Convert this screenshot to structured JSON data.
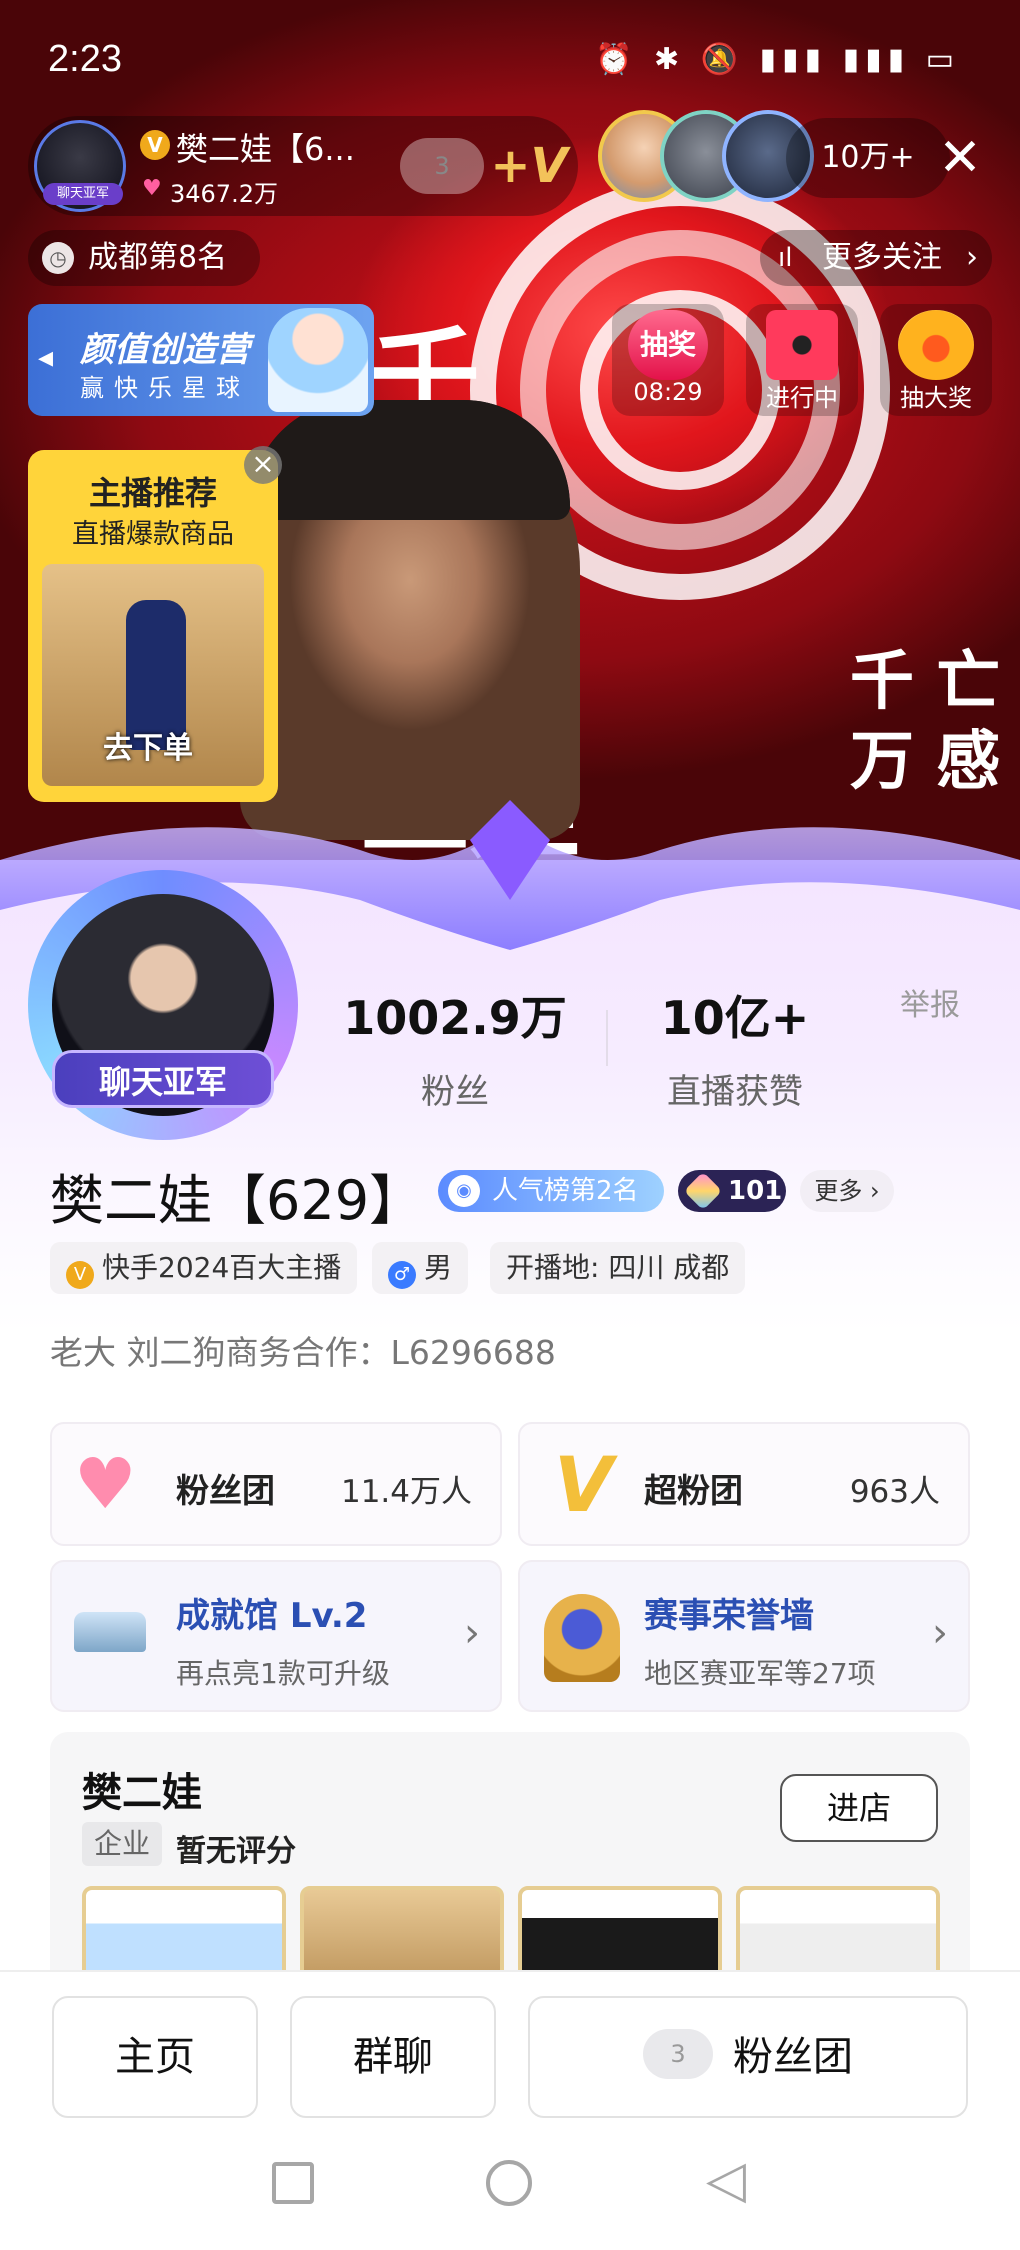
{
  "status_bar": {
    "time": "2:23"
  },
  "live": {
    "anchor_name": "樊二娃【6...",
    "anchor_likes": "3467.2万",
    "anchor_badge": "聊天亚军",
    "fan_level": "3",
    "viewer_count": "10万+",
    "city_rank": "成都第8名",
    "more_follow": "更多关注",
    "promo_title": "颜值创造营",
    "promo_sub": "赢快乐星球",
    "lottery_label": "抽奖",
    "lottery_timer": "08:29",
    "ongoing_label": "进行中",
    "big_prize_label": "抽大奖",
    "rec_title": "主播推荐",
    "rec_sub": "直播爆款商品",
    "rec_cta": "去下单"
  },
  "profile": {
    "avatar_ribbon": "聊天亚军",
    "fans_count": "1002.9万",
    "fans_label": "粉丝",
    "likes_count": "10亿+",
    "likes_label": "直播获赞",
    "report": "举报",
    "name": "樊二娃【629】",
    "popularity_rank": "人气榜第2名",
    "level": "101",
    "more": "更多",
    "tags": [
      "快手2024百大主播",
      "男",
      "开播地: 四川 成都"
    ],
    "bio": "老大 刘二狗商务合作：L6296688"
  },
  "cards": {
    "fan_club": {
      "name": "粉丝团",
      "value": "11.4万人"
    },
    "super_fan": {
      "name": "超粉团",
      "value": "963人"
    },
    "achievement": {
      "name": "成就馆 Lv.2",
      "sub": "再点亮1款可升级"
    },
    "honor": {
      "name": "赛事荣誉墙",
      "sub": "地区赛亚军等27项"
    }
  },
  "shop": {
    "name": "樊二娃",
    "tag": "企业",
    "rating": "暂无评分",
    "enter": "进店"
  },
  "bottom_bar": {
    "home": "主页",
    "group_chat": "群聊",
    "fan_club": "粉丝团",
    "fan_level": "3"
  },
  "icons": [
    "clock-icon",
    "chart-icon",
    "close-icon",
    "heart-icon",
    "v-icon",
    "crown-icon",
    "trophy-icon",
    "square-nav-icon",
    "circle-nav-icon",
    "back-nav-icon"
  ],
  "colors": {
    "accent_blue": "#2b4fb3",
    "live_red": "#e1161c",
    "rec_yellow": "#ffd43a",
    "vip_gold": "#f0a91b"
  }
}
